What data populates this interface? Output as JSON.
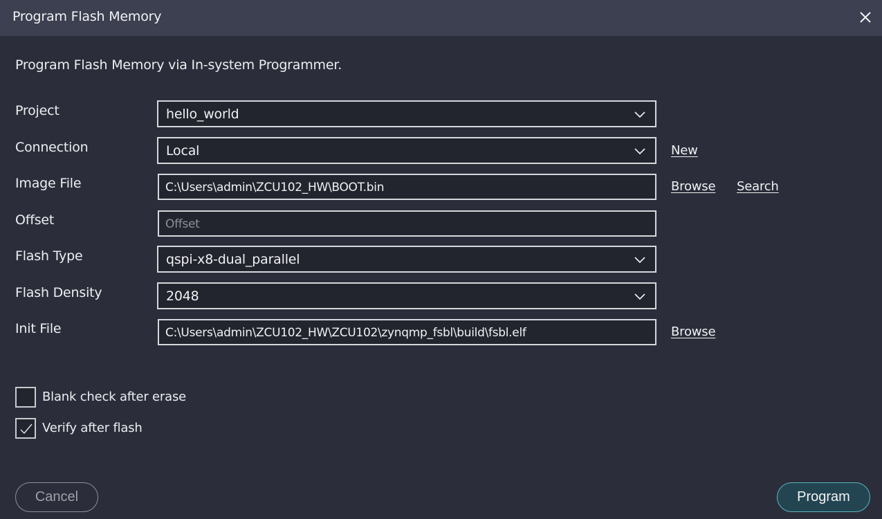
{
  "dialog": {
    "title": "Program Flash Memory",
    "close_icon": "close-icon",
    "description": "Program Flash Memory via In-system Programmer."
  },
  "form": {
    "project": {
      "label": "Project",
      "value": "hello_world",
      "type": "select"
    },
    "connection": {
      "label": "Connection",
      "value": "Local",
      "type": "select",
      "link": "New"
    },
    "image_file": {
      "label": "Image File",
      "value": "C:\\Users\\admin\\ZCU102_HW\\BOOT.bin",
      "type": "text",
      "links": [
        "Browse",
        "Search"
      ]
    },
    "offset": {
      "label": "Offset",
      "value": "",
      "placeholder": "Offset",
      "type": "text"
    },
    "flash_type": {
      "label": "Flash Type",
      "value": "qspi-x8-dual_parallel",
      "type": "select"
    },
    "flash_density": {
      "label": "Flash Density",
      "value": "2048",
      "type": "select"
    },
    "init_file": {
      "label": "Init File",
      "value": "C:\\Users\\admin\\ZCU102_HW\\ZCU102\\zynqmp_fsbl\\build\\fsbl.elf",
      "type": "text",
      "link": "Browse"
    }
  },
  "options": {
    "blank_check": {
      "label": "Blank check after erase",
      "checked": false
    },
    "verify": {
      "label": "Verify after flash",
      "checked": true
    }
  },
  "buttons": {
    "cancel": "Cancel",
    "program": "Program"
  },
  "colors": {
    "titlebar": "#3c4050",
    "background": "#2b2e3a",
    "field_bg": "#22252e",
    "field_border": "#d6d8dc",
    "program_bg": "#234552",
    "program_border": "#5ab5bf"
  }
}
